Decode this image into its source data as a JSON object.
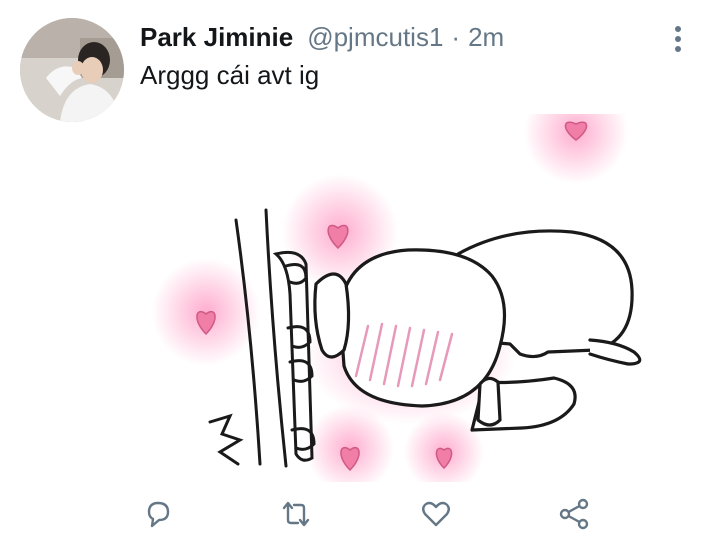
{
  "tweet": {
    "author_name": "Park Jiminie",
    "author_handle": "@pjmcutis1",
    "separator": "·",
    "time": "2m",
    "text": "Arggg cái avt ig"
  },
  "icons": {
    "more": "more-vertical-icon",
    "reply": "reply-icon",
    "retweet": "retweet-icon",
    "like": "heart-icon",
    "share": "share-icon"
  },
  "colors": {
    "name": "#14171a",
    "secondary": "#657786",
    "heart_pink": "#f07ea6",
    "glow_pink": "#ff9fc6"
  }
}
